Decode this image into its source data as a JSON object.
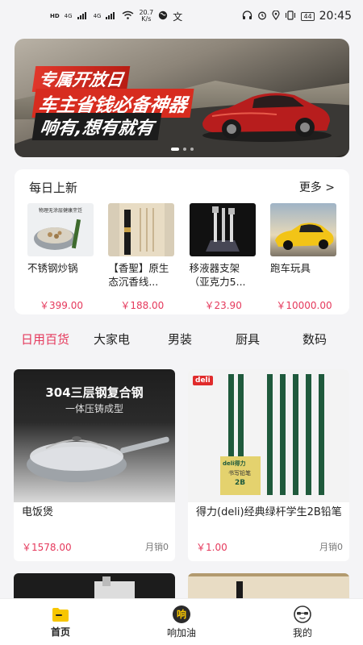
{
  "status_bar": {
    "network_speed": "20.7\nK/s",
    "speed_value": "20.7",
    "speed_unit": "K/s",
    "signal_1": "4G",
    "signal_2": "4G",
    "hd_label": "HD",
    "battery": "44",
    "time": "20:45"
  },
  "banner": {
    "line1": "专属开放日",
    "line2": "车主省钱必备神器",
    "line3": "响有,想有就有",
    "slide_count": 3,
    "active_slide": 1
  },
  "daily": {
    "title": "每日上新",
    "more": "更多 >",
    "items": [
      {
        "name": "不锈钢炒锅",
        "price": "￥399.00",
        "img_caption": "物理无涂层健康烹饪"
      },
      {
        "name": "【香聖】原生态沉香线...",
        "price": "￥188.00"
      },
      {
        "name": "移液器支架（亚克力5...",
        "price": "￥23.90"
      },
      {
        "name": "跑车玩具",
        "price": "￥10000.00"
      }
    ]
  },
  "tabs": [
    {
      "label": "日用百货",
      "active": true
    },
    {
      "label": "大家电",
      "active": false
    },
    {
      "label": "男装",
      "active": false
    },
    {
      "label": "厨具",
      "active": false
    },
    {
      "label": "数码",
      "active": false
    }
  ],
  "products": [
    {
      "name": "电饭煲",
      "price": "￥1578.00",
      "sales": "月销0",
      "img_title": "304三层钢复合钢",
      "img_subtitle": "一体压铸成型"
    },
    {
      "name": "得力(deli)经典绿杆学生2B铅笔",
      "price": "￥1.00",
      "sales": "月销0",
      "brand": "deli",
      "box_label": "deli得力",
      "box_sub": "书写铅笔",
      "grade": "2B"
    }
  ],
  "bottom_nav": [
    {
      "label": "首页",
      "icon": "home-folder-icon",
      "active": true
    },
    {
      "label": "响加油",
      "icon": "xiang-coin-icon",
      "active": false,
      "icon_char": "响"
    },
    {
      "label": "我的",
      "icon": "profile-face-icon",
      "active": false
    }
  ],
  "colors": {
    "accent": "#e5395c",
    "nav_home": "#f7c600",
    "nav_coin": "#2a2a2a"
  }
}
